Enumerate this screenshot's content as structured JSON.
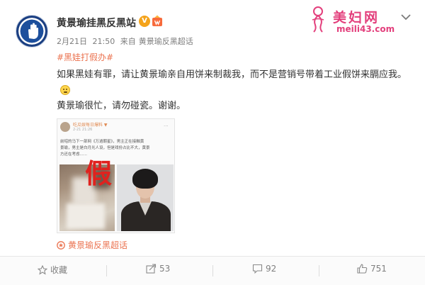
{
  "post": {
    "username": "黄景瑜挂黑反黑站",
    "verified_badge": "V",
    "meta": {
      "date": "2月21日",
      "time": "21:50",
      "source_prefix": "来自",
      "source": "黄景瑜反黑超话"
    },
    "hashtag": "#黑娃打假办#",
    "body_line1": "如果黑娃有罪，请让黄景瑜亲自用饼来制裁我，而不是营销号带着工业假饼来膈应我。",
    "body_line2": "黄景瑜很忙，请勿碰瓷。谢谢。",
    "footer_tag": "黄景瑜反黑超话"
  },
  "watermark": {
    "title": "美妇网",
    "url": "meili43.com"
  },
  "quoted_card": {
    "name": "吃瓜娱每日爆料 ▼",
    "time": "2-21 21:26",
    "text_lines": [
      "前绍的马下一部网《万逍朝星》，男主正在接触黄",
      "景瑜，男主是白月光人设，但是戏份占比不大，黄景",
      "方还在考虑......"
    ],
    "stamp": "假"
  },
  "actions": {
    "favorite_label": "收藏",
    "repost_count": "53",
    "comment_count": "92",
    "like_count": "751"
  },
  "colors": {
    "link_orange": "#eb7350",
    "watermark_pink": "#e33f7c",
    "verified_gold": "#f4a31b"
  },
  "icons": [
    "avatar-logo",
    "verified-icon",
    "member-icon",
    "chevron-down-icon",
    "watermark-logo-icon",
    "supertopic-icon",
    "star-icon",
    "repost-icon",
    "comment-icon",
    "like-icon"
  ]
}
